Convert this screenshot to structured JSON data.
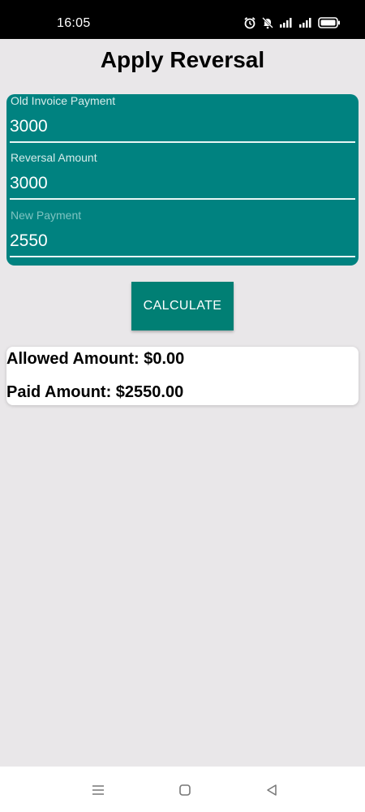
{
  "status_bar": {
    "time": "16:05",
    "icons": [
      "alarm-icon",
      "mute-icon",
      "signal-icon",
      "signal-icon",
      "battery-icon"
    ]
  },
  "page": {
    "title": "Apply Reversal"
  },
  "form": {
    "fields": [
      {
        "label": "Old Invoice Payment",
        "value": "3000"
      },
      {
        "label": "Reversal Amount",
        "value": "3000"
      },
      {
        "label": "New Payment",
        "value": "2550"
      }
    ]
  },
  "actions": {
    "calculate_label": "CALCULATE"
  },
  "results": {
    "allowed": "Allowed Amount: $0.00",
    "paid": "Paid Amount: $2550.00"
  },
  "nav": {
    "icons": [
      "menu-icon",
      "home-icon",
      "back-icon"
    ]
  },
  "colors": {
    "card": "#008280",
    "button": "#017f74",
    "background": "#e9e7e9"
  }
}
